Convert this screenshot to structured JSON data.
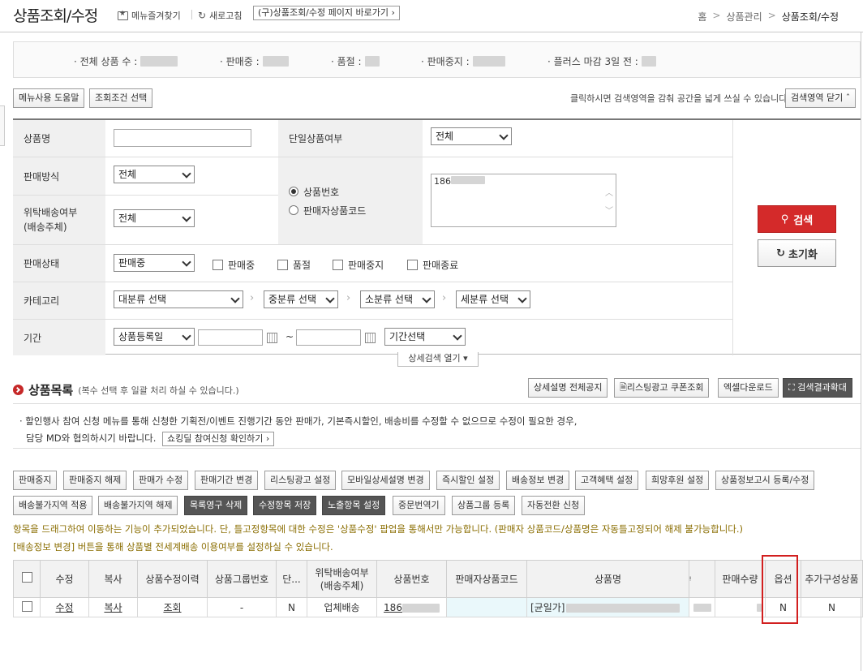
{
  "header": {
    "title": "상품조회/수정",
    "favorite_label": "메뉴즐겨찾기",
    "refresh_label": "새로고침",
    "old_page_label": "(구)상품조회/수정 페이지 바로가기",
    "breadcrumb": [
      "홈",
      "상품관리",
      "상품조회/수정"
    ]
  },
  "summary": {
    "total": "· 전체 상품 수 :",
    "selling": "· 판매중 :",
    "soldout": "· 품절 :",
    "stopped": "· 판매중지 :",
    "plus": "· 플러스 마감 3일 전 :"
  },
  "toolbar": {
    "help_label": "메뉴사용 도움말",
    "condition_label": "조회조건 선택",
    "collapse_hint": "클릭하시면 검색영역을 감춰 공간을 넓게 쓰실 수 있습니다.",
    "collapse_label": "검색영역 닫기"
  },
  "search": {
    "product_name_label": "상품명",
    "single_label": "단일상품여부",
    "single_value": "전체",
    "sale_method_label": "판매방식",
    "sale_method_value": "전체",
    "consign_label_1": "위탁배송여부",
    "consign_label_2": "(배송주체)",
    "consign_value": "전체",
    "radio_product_no": "상품번호",
    "radio_seller_code": "판매자상품코드",
    "product_no_value": "186",
    "status_label": "판매상태",
    "status_value": "판매중",
    "status_checks": [
      "판매중",
      "품절",
      "판매중지",
      "판매종료"
    ],
    "category_label": "카테고리",
    "category_selects": [
      "대분류 선택",
      "중분류 선택",
      "소분류 선택",
      "세분류 선택"
    ],
    "period_label": "기간",
    "period_type": "상품등록일",
    "period_tilde": "~",
    "period_preset": "기간선택",
    "search_label": "검색",
    "reset_label": "초기화",
    "detail_label": "상세검색 열기"
  },
  "list": {
    "title": "상품목록",
    "subtitle": "(복수 선택 후 일괄 처리 하실 수 있습니다.)",
    "top_buttons": [
      "상세설명 전체공지",
      "리스팅광고 쿠폰조회",
      "엑셀다운로드",
      "검색결과확대"
    ],
    "notice_line1": "· 할인행사 참여 신청 메뉴를 통해 신청한 기획전/이벤트 진행기간 동안 판매가, 기본즉시할인, 배송비를 수정할 수 없으므로 수정이 필요한 경우,",
    "notice_line2": "담당 MD와 협의하시기 바랍니다.",
    "notice_button": "쇼킹딜 참여신청 확인하기",
    "actions_row1": [
      "판매중지",
      "판매중지 해제",
      "판매가 수정",
      "판매기간 변경",
      "리스팅광고 설정",
      "모바일상세설명 변경",
      "즉시할인 설정",
      "배송정보 변경",
      "고객혜택 설정",
      "희망후원 설정",
      "상품정보고시 등록/수정"
    ],
    "actions_row2": [
      "배송불가지역 적용",
      "배송불가지역 해제",
      "목록영구 삭제",
      "수정항목 저장",
      "노출항목 설정",
      "중문번역기",
      "상품그룹 등록",
      "자동전환 신청"
    ],
    "warn1": "항목을 드래그하여 이동하는 기능이 추가되었습니다. 단, 틀고정항목에 대한 수정은 '상품수정' 팝업을 통해서만 가능합니다. (판매자 상품코드/상품명은 자동틀고정되어 해제 불가능합니다.)",
    "warn2": "[배송정보 변경] 버튼을 통해 상품별 전세계배송 이용여부를 설정하실 수 있습니다."
  },
  "table": {
    "headers": [
      "수정",
      "복사",
      "상품수정이력",
      "상품그룹번호",
      "단...",
      "위탁배송여부",
      "(배송주체)",
      "상품번호",
      "판매자상품코드",
      "상품명",
      "",
      "판매수량",
      "옵션",
      "추가구성상품"
    ],
    "row": {
      "edit": "수정",
      "copy": "복사",
      "history": "조회",
      "group": "-",
      "single": "N",
      "consign": "업체배송",
      "product_no": "186",
      "name_prefix": "[균일가]",
      "option": "N",
      "addon": "N"
    }
  }
}
